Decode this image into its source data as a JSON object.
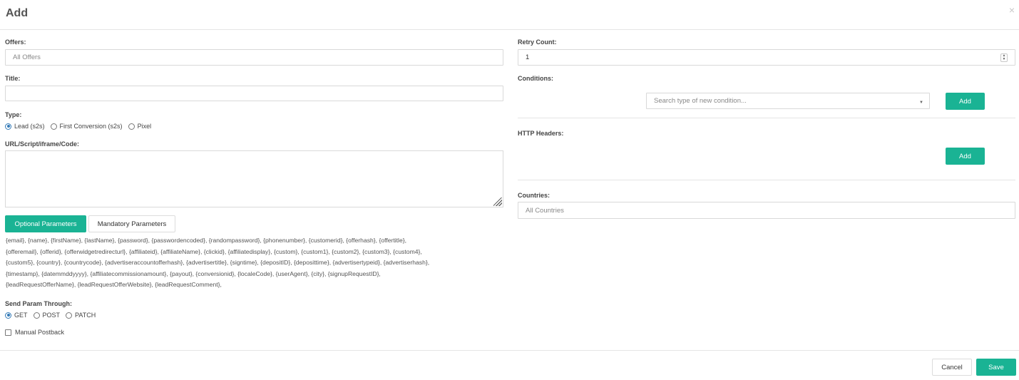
{
  "header": {
    "title": "Add",
    "close_glyph": "×"
  },
  "offers": {
    "label": "Offers:",
    "placeholder": "All Offers"
  },
  "title_field": {
    "label": "Title:",
    "value": ""
  },
  "type": {
    "label": "Type:",
    "options": [
      {
        "label": "Lead (s2s)",
        "selected": true
      },
      {
        "label": "First Conversion (s2s)",
        "selected": false
      },
      {
        "label": "Pixel",
        "selected": false
      }
    ]
  },
  "url": {
    "label": "URL/Script/iframe/Code:",
    "value": ""
  },
  "param_tabs": {
    "optional": "Optional Parameters",
    "mandatory": "Mandatory Parameters",
    "active": "optional"
  },
  "params_lines": [
    "{email}, {name}, {firstName}, {lastName}, {password}, {passwordencoded}, {randompassword}, {phonenumber}, {customerid}, {offerhash}, {offertitle},",
    "{offeremail}, {offerid}, {offerwidgetredirecturl}, {affiliateid}, {affiliateName}, {clickid}, {affiliatedisplay}, {custom}, {custom1}, {custom2}, {custom3}, {custom4},",
    "{custom5}, {country}, {countrycode}, {advertiseraccountofferhash}, {advertisertitle}, {signtime}, {depositID}, {deposittime}, {advertisertypeid}, {advertiserhash},",
    "{timestamp}, {datemmddyyyy}, {affiliatecommissionamount}, {payout}, {conversionid}, {localeCode}, {userAgent}, {city}, {signupRequestID},",
    "{leadRequestOfferName}, {leadRequestOfferWebsite}, {leadRequestComment},"
  ],
  "send_param": {
    "label": "Send Param Through:",
    "options": [
      {
        "label": "GET",
        "selected": true
      },
      {
        "label": "POST",
        "selected": false
      },
      {
        "label": "PATCH",
        "selected": false
      }
    ]
  },
  "manual_postback": {
    "label": "Manual Postback",
    "checked": false
  },
  "retry": {
    "label": "Retry Count:",
    "value": "1"
  },
  "conditions": {
    "label": "Conditions:",
    "placeholder": "Search type of new condition...",
    "add_label": "Add"
  },
  "http_headers": {
    "label": "HTTP Headers:",
    "add_label": "Add"
  },
  "countries": {
    "label": "Countries:",
    "placeholder": "All Countries"
  },
  "footer": {
    "cancel_label": "Cancel",
    "save_label": "Save"
  },
  "colors": {
    "accent": "#1ab394",
    "radio": "#337ab7"
  }
}
